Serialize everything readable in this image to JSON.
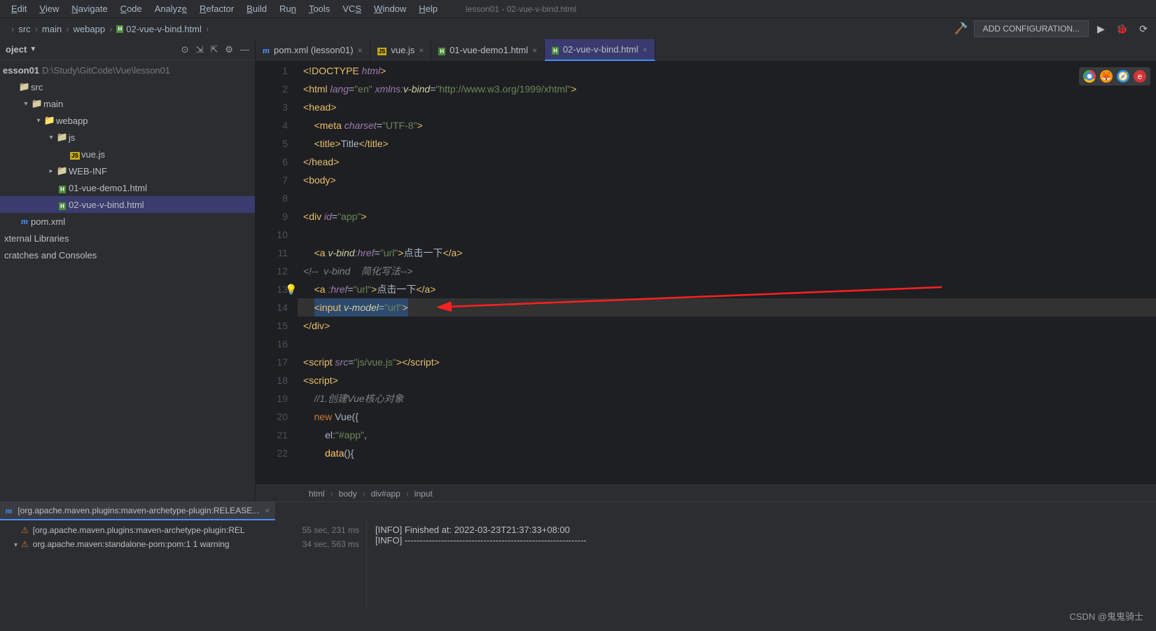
{
  "window": {
    "title": "lesson01 - 02-vue-v-bind.html"
  },
  "menus": [
    "Edit",
    "View",
    "Navigate",
    "Code",
    "Analyze",
    "Refactor",
    "Build",
    "Run",
    "Tools",
    "VCS",
    "Window",
    "Help"
  ],
  "menu_underlines": [
    0,
    0,
    0,
    0,
    6,
    0,
    0,
    2,
    0,
    2,
    0,
    0
  ],
  "breadcrumb": [
    "src",
    "main",
    "webapp",
    "02-vue-v-bind.html"
  ],
  "toolbar": {
    "add_config": "ADD CONFIGURATION..."
  },
  "project": {
    "label": "oject",
    "root": {
      "name": "esson01",
      "path": "D:\\Study\\GitCode\\Vue\\lesson01"
    },
    "tree": [
      {
        "indent": 0,
        "arrow": "",
        "icon": "folder",
        "label": "src"
      },
      {
        "indent": 1,
        "arrow": "▾",
        "icon": "folder",
        "label": "main"
      },
      {
        "indent": 2,
        "arrow": "▾",
        "icon": "folder-blue",
        "label": "webapp"
      },
      {
        "indent": 3,
        "arrow": "▾",
        "icon": "folder",
        "label": "js"
      },
      {
        "indent": 4,
        "arrow": "",
        "icon": "js",
        "label": "vue.js"
      },
      {
        "indent": 3,
        "arrow": "▸",
        "icon": "folder",
        "label": "WEB-INF"
      },
      {
        "indent": 3,
        "arrow": "",
        "icon": "html",
        "label": "01-vue-demo1.html"
      },
      {
        "indent": 3,
        "arrow": "",
        "icon": "html",
        "label": "02-vue-v-bind.html",
        "selected": true
      },
      {
        "indent": 0,
        "arrow": "",
        "icon": "m",
        "label": "pom.xml"
      }
    ],
    "extra": [
      "xternal Libraries",
      "cratches and Consoles"
    ]
  },
  "tabs": [
    {
      "icon": "m",
      "label": "pom.xml (lesson01)"
    },
    {
      "icon": "js",
      "label": "vue.js"
    },
    {
      "icon": "html",
      "label": "01-vue-demo1.html"
    },
    {
      "icon": "html",
      "label": "02-vue-v-bind.html",
      "active": true
    }
  ],
  "code_crumb": [
    "html",
    "body",
    "div#app",
    "input"
  ],
  "code_lines": 22,
  "run_panel": {
    "tab_label": "[org.apache.maven.plugins:maven-archetype-plugin:RELEASE...",
    "items": [
      {
        "name": "[org.apache.maven.plugins:maven-archetype-plugin:REL",
        "time": "55 sec, 231 ms",
        "arrow": ""
      },
      {
        "name": "org.apache.maven:standalone-pom:pom:1  1 warning",
        "time": "34 sec, 563 ms",
        "arrow": "▾"
      }
    ],
    "console": [
      "[INFO] Finished at: 2022-03-23T21:37:33+08:00",
      "[INFO] ------------------------------------------------------------"
    ]
  },
  "watermark": "CSDN @鬼鬼骑士"
}
